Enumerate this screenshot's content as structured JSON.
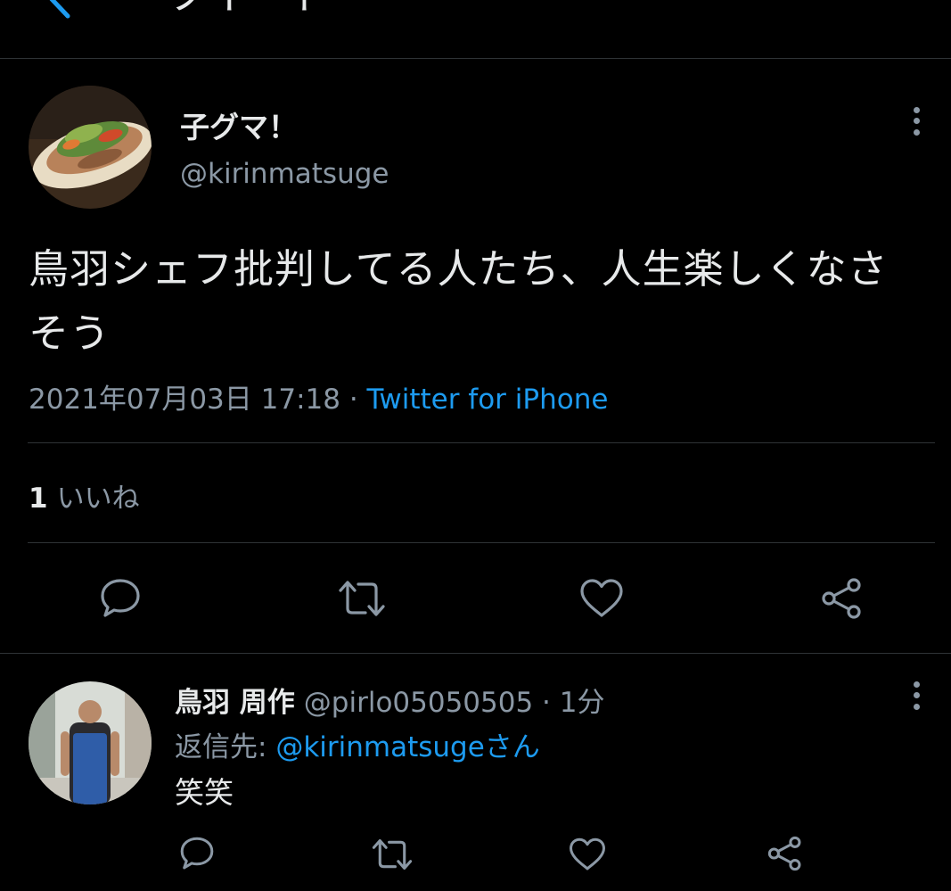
{
  "header": {
    "title": "ツイート"
  },
  "tweet": {
    "author_name": "子グマ！",
    "author_handle": "@kirinmatsuge",
    "text": "鳥羽シェフ批判してる人たち、人生楽しくなさそう",
    "timestamp": "2021年07月03日 17:18",
    "separator": " · ",
    "source": "Twitter for iPhone",
    "like_count": "1",
    "like_label": "いいね"
  },
  "actions": [
    "reply-icon",
    "retweet-icon",
    "like-icon",
    "share-icon"
  ],
  "reply": {
    "author_name": "鳥羽 周作",
    "author_handle": "@pirlo05050505",
    "separator": " · ",
    "time": "1分",
    "reply_to_label": "返信先: ",
    "reply_to_handle": "@kirinmatsugeさん",
    "text": "笑笑"
  },
  "colors": {
    "background": "#000000",
    "text_primary": "#e7e9ea",
    "text_secondary": "#8b98a5",
    "accent": "#1d9bf0",
    "divider": "#2f3336"
  }
}
